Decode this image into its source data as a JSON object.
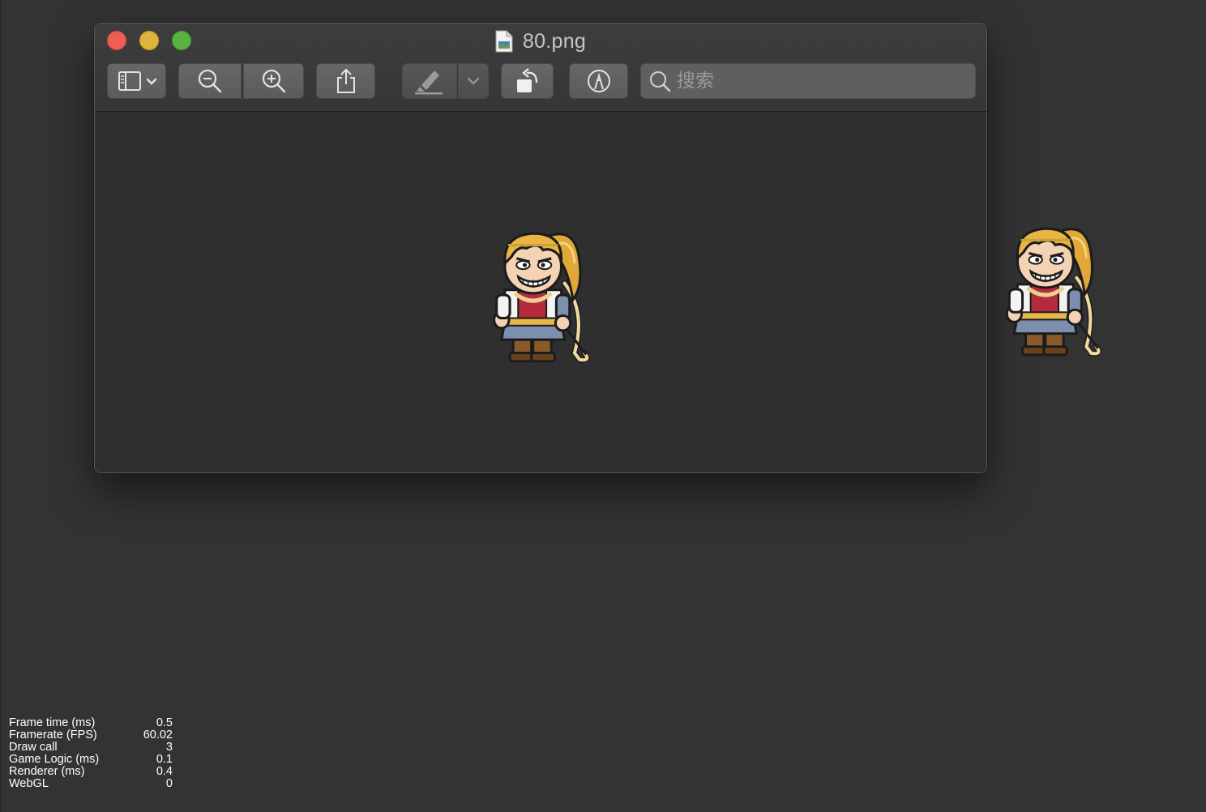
{
  "window": {
    "title": "80.png",
    "file_icon": "png-document-icon",
    "traffic_lights": {
      "close": "#ee5e56",
      "minimize": "#dfb43a",
      "zoom": "#58b343"
    }
  },
  "toolbar": {
    "buttons": [
      {
        "id": "sidebar",
        "icon": "sidebar-toggle-icon"
      },
      {
        "id": "zoom_out",
        "icon": "zoom-out-icon"
      },
      {
        "id": "zoom_in",
        "icon": "zoom-in-icon"
      },
      {
        "id": "share",
        "icon": "share-icon"
      },
      {
        "id": "highlight",
        "icon": "highlighter-icon"
      },
      {
        "id": "highlight_menu",
        "icon": "chevron-down-icon"
      },
      {
        "id": "rotate",
        "icon": "rotate-left-icon"
      },
      {
        "id": "markup",
        "icon": "markup-pen-icon"
      }
    ],
    "search": {
      "placeholder": "搜索",
      "value": "",
      "icon": "search-icon"
    }
  },
  "content": {
    "image": "archer-girl-sprite"
  },
  "stats": [
    {
      "label": "Frame time (ms)",
      "value": "0.5"
    },
    {
      "label": "Framerate (FPS)",
      "value": "60.02"
    },
    {
      "label": "Draw call",
      "value": "3"
    },
    {
      "label": "Game Logic (ms)",
      "value": "0.1"
    },
    {
      "label": "Renderer (ms)",
      "value": "0.4"
    },
    {
      "label": "WebGL",
      "value": "0"
    }
  ],
  "colors": {
    "background": "#333333",
    "window": "#2f2f2f",
    "toolbar_button": "#636363",
    "text": "#c6c6c6"
  }
}
